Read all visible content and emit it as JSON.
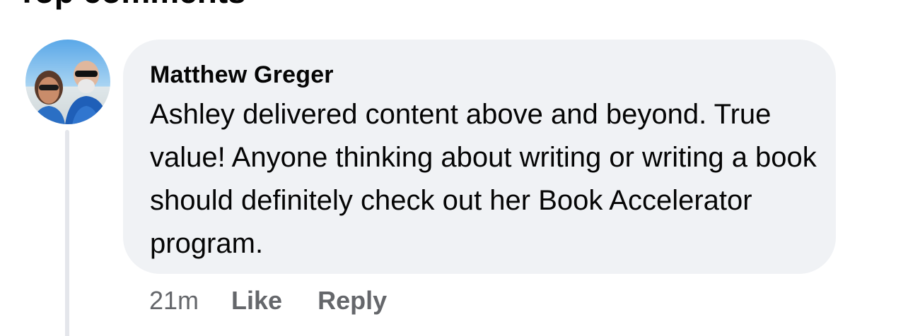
{
  "section": {
    "title": "Top comments"
  },
  "comment": {
    "author": "Matthew Greger",
    "text": "Ashley delivered content above and beyond. True value! Anyone thinking about writing or writing a book should definitely check out her Book Accelerator program.",
    "timestamp": "21m",
    "actions": {
      "like_label": "Like",
      "reply_label": "Reply"
    }
  },
  "colors": {
    "bubble_background": "#f0f2f5",
    "primary_text": "#050505",
    "secondary_text": "#65676b",
    "thread_line": "#e4e6eb"
  }
}
